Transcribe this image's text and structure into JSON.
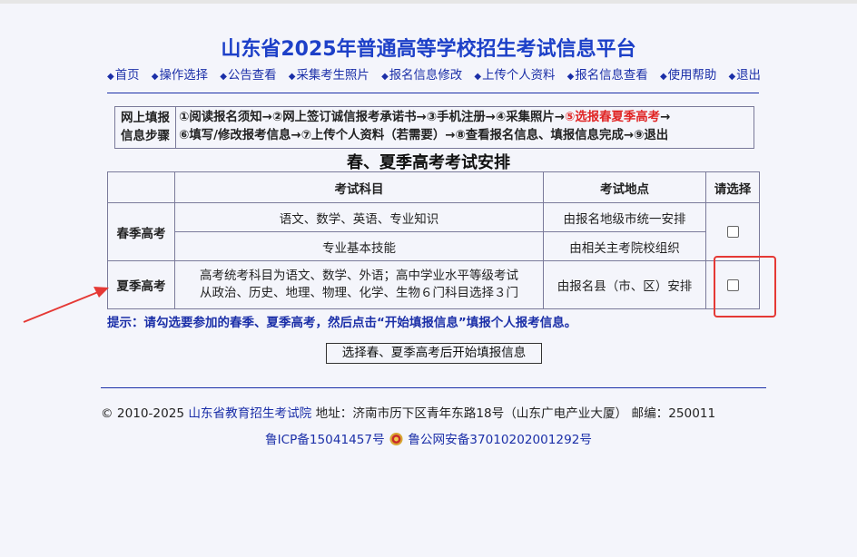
{
  "title": "山东省2025年普通高等学校招生考试信息平台",
  "nav": {
    "items": [
      "首页",
      "操作选择",
      "公告查看",
      "采集考生照片",
      "报名信息修改",
      "上传个人资料",
      "报名信息查看",
      "使用帮助",
      "退出"
    ]
  },
  "steps": {
    "label_line1": "网上填报",
    "label_line2": "信息步骤",
    "s1": "①阅读报名须知→②网上签订诚信报考承诺书→③手机注册→④采集照片→",
    "s_current": "⑤选报春夏季高考",
    "s1_tail": "→",
    "s2": "⑥填写/修改报考信息→⑦上传个人资料（若需要）→⑧查看报名信息、填报信息完成→⑨退出"
  },
  "table": {
    "title": "春、夏季高考考试安排",
    "headers": [
      "",
      "考试科目",
      "考试地点",
      "请选择"
    ],
    "spring": {
      "label": "春季高考",
      "rows": [
        {
          "subject": "语文、数学、英语、专业知识",
          "location": "由报名地级市统一安排"
        },
        {
          "subject": "专业基本技能",
          "location": "由相关主考院校组织"
        }
      ]
    },
    "summer": {
      "label": "夏季高考",
      "subject_line1": "高考统考科目为语文、数学、外语；高中学业水平等级考试",
      "subject_line2": "从政治、历史、地理、物理、化学、生物６门科目选择３门",
      "location": "由报名县（市、区）安排"
    }
  },
  "hint": "提示：请勾选要参加的春季、夏季高考，然后点击“开始填报信息”填报个人报考信息。",
  "start_button": "选择春、夏季高考后开始填报信息",
  "footer": {
    "copyright": "© 2010-2025",
    "org": "山东省教育招生考试院",
    "address": "地址：济南市历下区青年东路18号（山东广电产业大厦） 邮编：250011",
    "icp": "鲁ICP备15041457号",
    "police": "鲁公网安备37010202001292号"
  },
  "colors": {
    "title": "#1d40c8",
    "link": "#1b2fa8",
    "current_step": "#e02424",
    "annotation": "#e53935"
  }
}
